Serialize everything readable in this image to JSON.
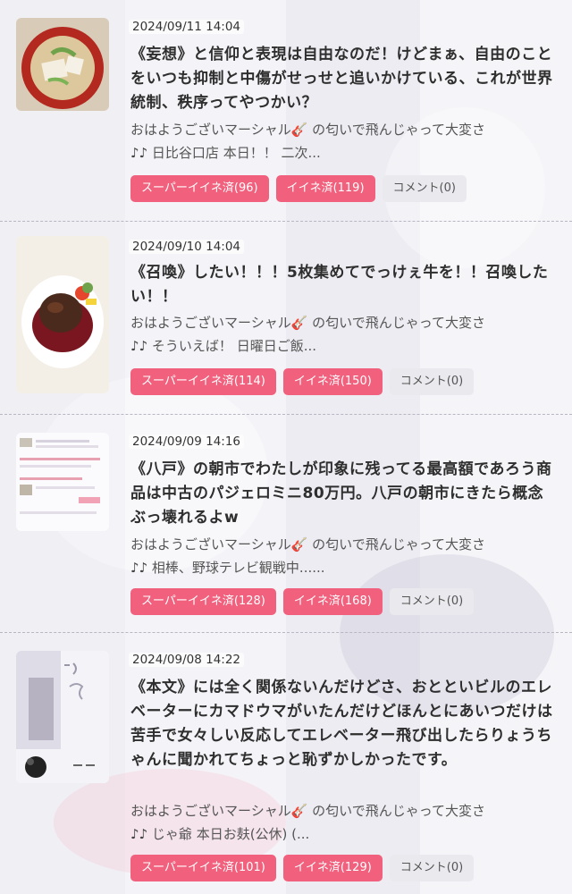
{
  "snippet_prefix": "おはようございマーシャル",
  "snippet_suffix": " の匂いで飛んじゃって大変さ",
  "notes_glyph": "♪♪",
  "guitar_glyph": "🎸",
  "colors": {
    "button_pink": "#f1607c",
    "button_gray": "#e9e9ee"
  },
  "posts": [
    {
      "date": "2024/09/11 14:04",
      "title": "《妄想》と信仰と表現は自由なのだ！けどまぁ、自由のことをいつも抑制と中傷がせっせと追いかけている、これが世界統制、秩序ってやつかい？",
      "snippet_tail": " 日比谷口店 本日！！ 二次...",
      "super_like": "スーパーイイネ済(96)",
      "like": "イイネ済(119)",
      "comment": "コメント(0)",
      "thumb": "miso-soup-image"
    },
    {
      "date": "2024/09/10 14:04",
      "title": "《召喚》したい！！！5枚集めてでっけぇ牛を！！召喚したい！！",
      "snippet_tail": " そういえば！ 日曜日ご飯...",
      "super_like": "スーパーイイネ済(114)",
      "like": "イイネ済(150)",
      "comment": "コメント(0)",
      "thumb": "steak-image"
    },
    {
      "date": "2024/09/09 14:16",
      "title": "《八戸》の朝市でわたしが印象に残ってる最高額であろう商品は中古のパジェロミニ80万円。八戸の朝市にきたら概念ぶっ壊れるよw",
      "snippet_tail": " 相棒、野球テレビ観戦中......",
      "super_like": "スーパーイイネ済(128)",
      "like": "イイネ済(168)",
      "comment": "コメント(0)",
      "thumb": "screenshot-image"
    },
    {
      "date": "2024/09/08 14:22",
      "title": "《本文》には全く関係ないんだけどさ、おとといビルのエレベーターにカマドウマがいたんだけどほんとにあいつだけは苦手で女々しい反応してエレベーター飛び出したらりょうちゃんに聞かれてちょっと恥ずかしかったです。",
      "snippet_tail": " じゃ爺 本日お麸(公休) (...",
      "super_like": "スーパーイイネ済(101)",
      "like": "イイネ済(129)",
      "comment": "コメント(0)",
      "thumb": "shirt-poster-image"
    }
  ]
}
